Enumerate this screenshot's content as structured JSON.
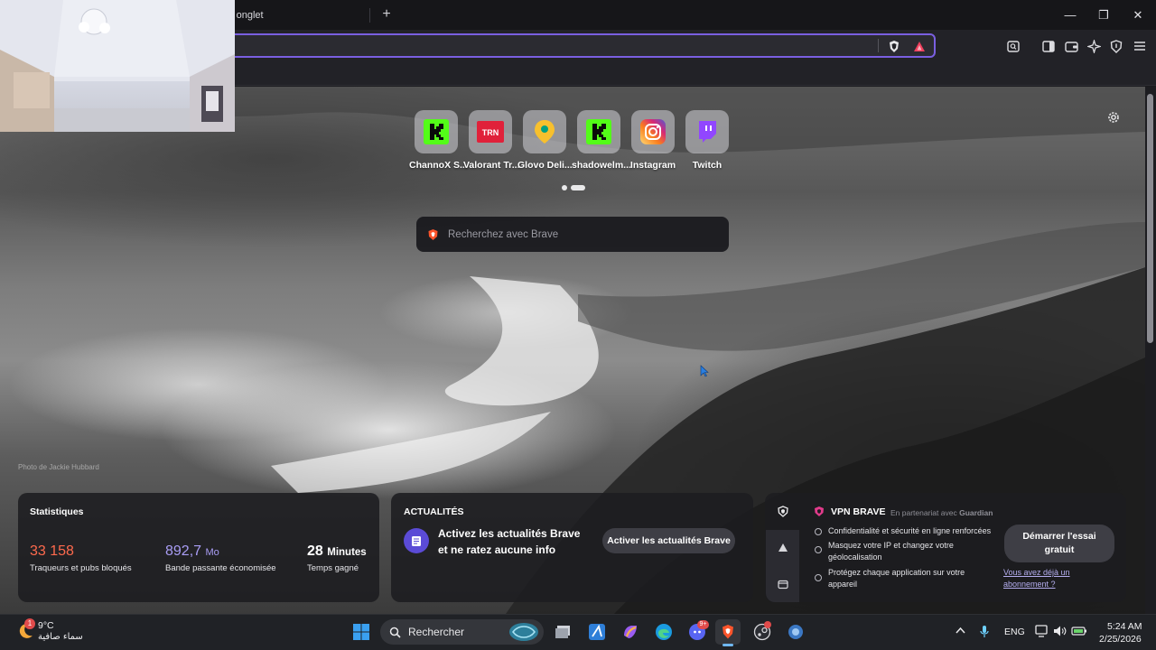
{
  "browser": {
    "tab_title": "Nouvel onglet",
    "tab_title_visible": "el onglet",
    "new_tab": "+",
    "window_controls": {
      "minimize": "—",
      "maximize": "❐",
      "close": "✕"
    }
  },
  "top_sites": [
    {
      "label": "ChannoX S...",
      "icon": "kick-icon",
      "color": "#53fc18"
    },
    {
      "label": "Valorant Tr...",
      "icon": "trn-icon",
      "color": "#e0213a",
      "text": "TRN"
    },
    {
      "label": "Glovo Deli...",
      "icon": "glovo-icon",
      "color": "#f7c02d"
    },
    {
      "label": "shadowelm...",
      "icon": "kick-icon",
      "color": "#53fc18"
    },
    {
      "label": "Instagram",
      "icon": "instagram-icon",
      "color": "#e1306c"
    },
    {
      "label": "Twitch",
      "icon": "twitch-icon",
      "color": "#9146ff"
    }
  ],
  "search": {
    "placeholder": "Recherchez avec Brave"
  },
  "photo_credit": "Photo de Jackie Hubbard",
  "stats": {
    "title": "Statistiques",
    "trackers_value": "33 158",
    "trackers_label": "Traqueurs et pubs bloqués",
    "bandwidth_value": "892,7",
    "bandwidth_unit": "Mo",
    "bandwidth_label": "Bande passante économisée",
    "time_value": "28",
    "time_unit": "Minutes",
    "time_label": "Temps gagné"
  },
  "news": {
    "title": "ACTUALITÉS",
    "message": "Activez les actualités Brave et ne ratez aucune info",
    "button": "Activer les actualités Brave"
  },
  "vpn": {
    "title": "VPN BRAVE",
    "partner": "En partenariat avec",
    "partner_name": "Guardian",
    "features": [
      "Confidentialité et sécurité en ligne renforcées",
      "Masquez votre IP et changez votre géolocalisation",
      "Protégez chaque application sur votre appareil"
    ],
    "cta": "Démarrer l'essai gratuit",
    "link": "Vous avez déjà un abonnement ?"
  },
  "taskbar": {
    "weather_temp": "9°C",
    "weather_desc": "سماء صافية",
    "weather_badge": "1",
    "search_label": "Rechercher",
    "language": "ENG",
    "time": "5:24 AM",
    "date": "2/25/2026",
    "discord_badge": "9+"
  },
  "colors": {
    "accent": "#7a5fe0",
    "brave_orange": "#fb542b",
    "trackers": "#ff6a4d",
    "bandwidth": "#a99df5"
  }
}
